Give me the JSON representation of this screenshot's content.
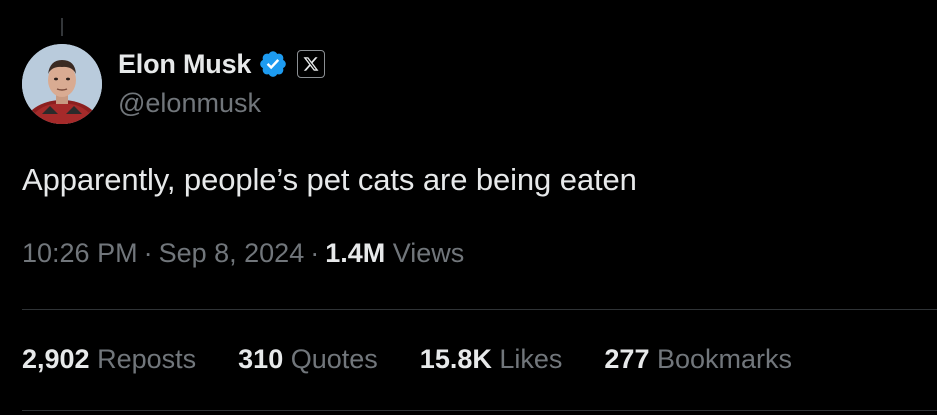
{
  "author": {
    "display_name": "Elon Musk",
    "handle": "@elonmusk",
    "verified": true,
    "verified_color": "#1d9bf0",
    "affiliate_icon": "x-logo-icon"
  },
  "tweet": {
    "text": "Apparently, people’s pet cats are being eaten",
    "time": "10:26 PM",
    "date": "Sep 8, 2024",
    "views_count": "1.4M",
    "views_label": "Views",
    "separator": "·"
  },
  "stats": [
    {
      "count": "2,902",
      "label": "Reposts"
    },
    {
      "count": "310",
      "label": "Quotes"
    },
    {
      "count": "15.8K",
      "label": "Likes"
    },
    {
      "count": "277",
      "label": "Bookmarks"
    }
  ],
  "colors": {
    "background": "#000000",
    "primary_text": "#e7e9ea",
    "secondary_text": "#71767b",
    "divider": "#2f3336"
  }
}
